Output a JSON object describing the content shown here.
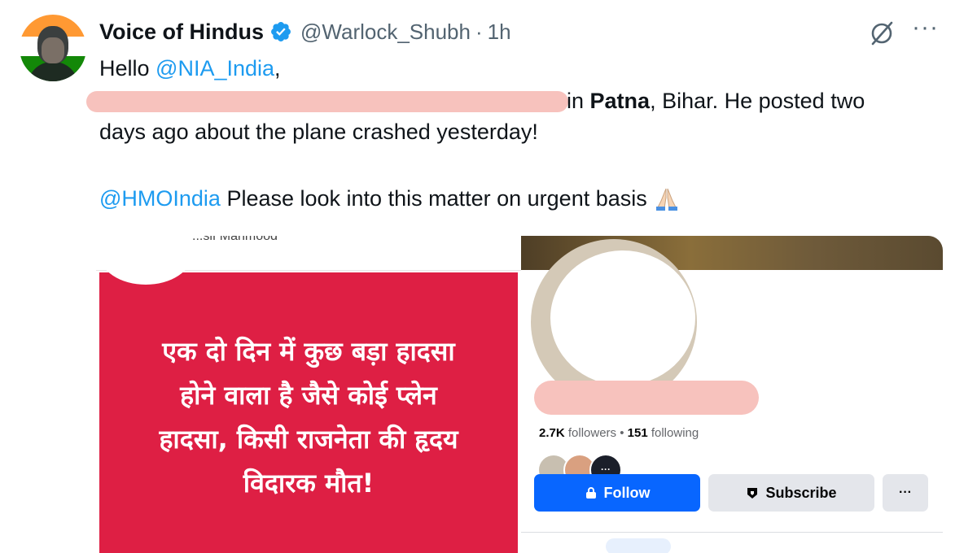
{
  "tweet": {
    "author_name": "Voice of Hindus",
    "handle": "@Warlock_Shubh",
    "separator": "·",
    "time": "1h",
    "greeting": "Hello ",
    "mention_nia": "@NIA_India",
    "greeting_tail": ",",
    "line2_pre": "in ",
    "line2_bold": "Patna",
    "line2_post": ", Bihar. He posted two",
    "line3": "days ago about the plane crashed yesterday!",
    "mention_hmo": "@HMOIndia",
    "line4_tail": " Please look into this matter on urgent basis",
    "verified_color": "#1d9bf0",
    "more_label": "···"
  },
  "screenshot_left": {
    "top_text": "...sif Mahmood",
    "hindi_lines": [
      "एक दो दिन में कुछ बड़ा हादसा",
      "होने वाला है जैसे कोई प्लेन",
      "हादसा, किसी राजनेता की हृदय",
      "विदारक मौत!"
    ],
    "card_color": "#de1f44"
  },
  "screenshot_right": {
    "followers_count": "2.7K",
    "followers_label": " followers",
    "dot": " • ",
    "following_count": "151",
    "following_label": " following",
    "mutual_more": "···",
    "follow_label": "Follow",
    "subscribe_label": "Subscribe",
    "more_label": "···",
    "accent": "#0866ff"
  }
}
